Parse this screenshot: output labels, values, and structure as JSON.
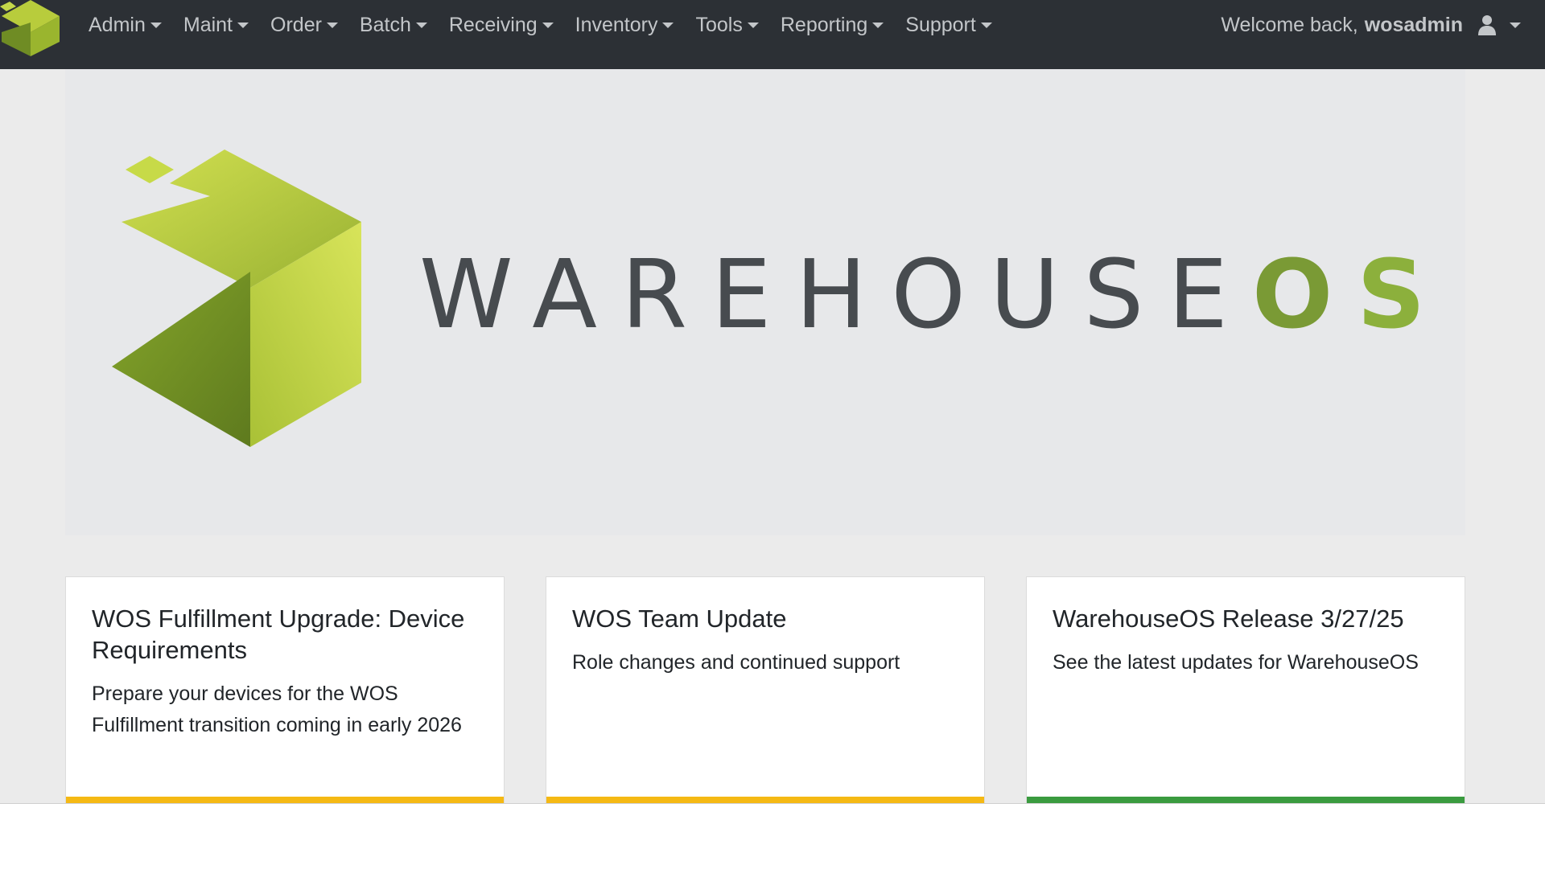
{
  "navbar": {
    "menu": [
      {
        "label": "Admin"
      },
      {
        "label": "Maint"
      },
      {
        "label": "Order"
      },
      {
        "label": "Batch"
      },
      {
        "label": "Receiving"
      },
      {
        "label": "Inventory"
      },
      {
        "label": "Tools"
      },
      {
        "label": "Reporting"
      },
      {
        "label": "Support"
      }
    ],
    "welcome_text": "Welcome back,",
    "username": "wosadmin",
    "user_icon": "user-icon",
    "brand_icon": "warehouseos-cube-logo-icon",
    "background_color": "#2c3035",
    "text_color": "#c3c6c9"
  },
  "hero": {
    "word_main": "WAREHOUSE",
    "word_os_o": "O",
    "word_os_s": "S",
    "logo_icon": "warehouseos-cube-logo-icon",
    "accent_color": "#7a9a35"
  },
  "cards": [
    {
      "title": "WOS Fulfillment Upgrade: Device Requirements",
      "text": "Prepare your devices for the WOS Fulfillment transition coming in early 2026",
      "bar_color": "#f5b914"
    },
    {
      "title": "WOS Team Update",
      "text": "Role changes and continued support",
      "bar_color": "#f5b914"
    },
    {
      "title": "WarehouseOS Release 3/27/25",
      "text": "See the latest updates for WarehouseOS",
      "bar_color": "#3a9b3f"
    }
  ]
}
